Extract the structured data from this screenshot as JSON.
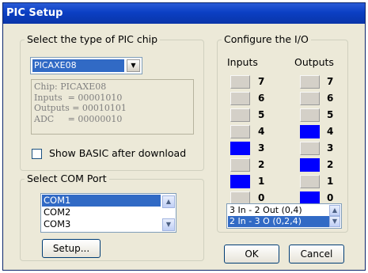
{
  "window": {
    "title": "PIC Setup"
  },
  "chip": {
    "group_label": "Select the type of PIC chip",
    "selected": "PICAXE08",
    "info_lines": [
      "Chip: PICAXE08",
      "Inputs  = 00001010",
      "Outputs = 00010101",
      "ADC     = 00000010"
    ],
    "show_basic_label": "Show BASIC after download",
    "show_basic_checked": false
  },
  "com": {
    "group_label": "Select COM Port",
    "ports": [
      "COM1",
      "COM2",
      "COM3"
    ],
    "selected": "COM1",
    "setup_label": "Setup..."
  },
  "io": {
    "group_label": "Configure the I/O",
    "inputs_label": "Inputs",
    "outputs_label": "Outputs",
    "pins": [
      "7",
      "6",
      "5",
      "4",
      "3",
      "2",
      "1",
      "0"
    ],
    "inputs_on": [
      false,
      false,
      false,
      false,
      true,
      false,
      true,
      false
    ],
    "outputs_on": [
      false,
      false,
      false,
      true,
      false,
      true,
      false,
      true
    ],
    "options": [
      "3 In - 2 Out (0,4)",
      "2 In - 3 O (0,2,4)"
    ],
    "selected_option": "2 In - 3 O (0,2,4)",
    "highlight_color": "#0000ff"
  },
  "buttons": {
    "ok": "OK",
    "cancel": "Cancel"
  }
}
